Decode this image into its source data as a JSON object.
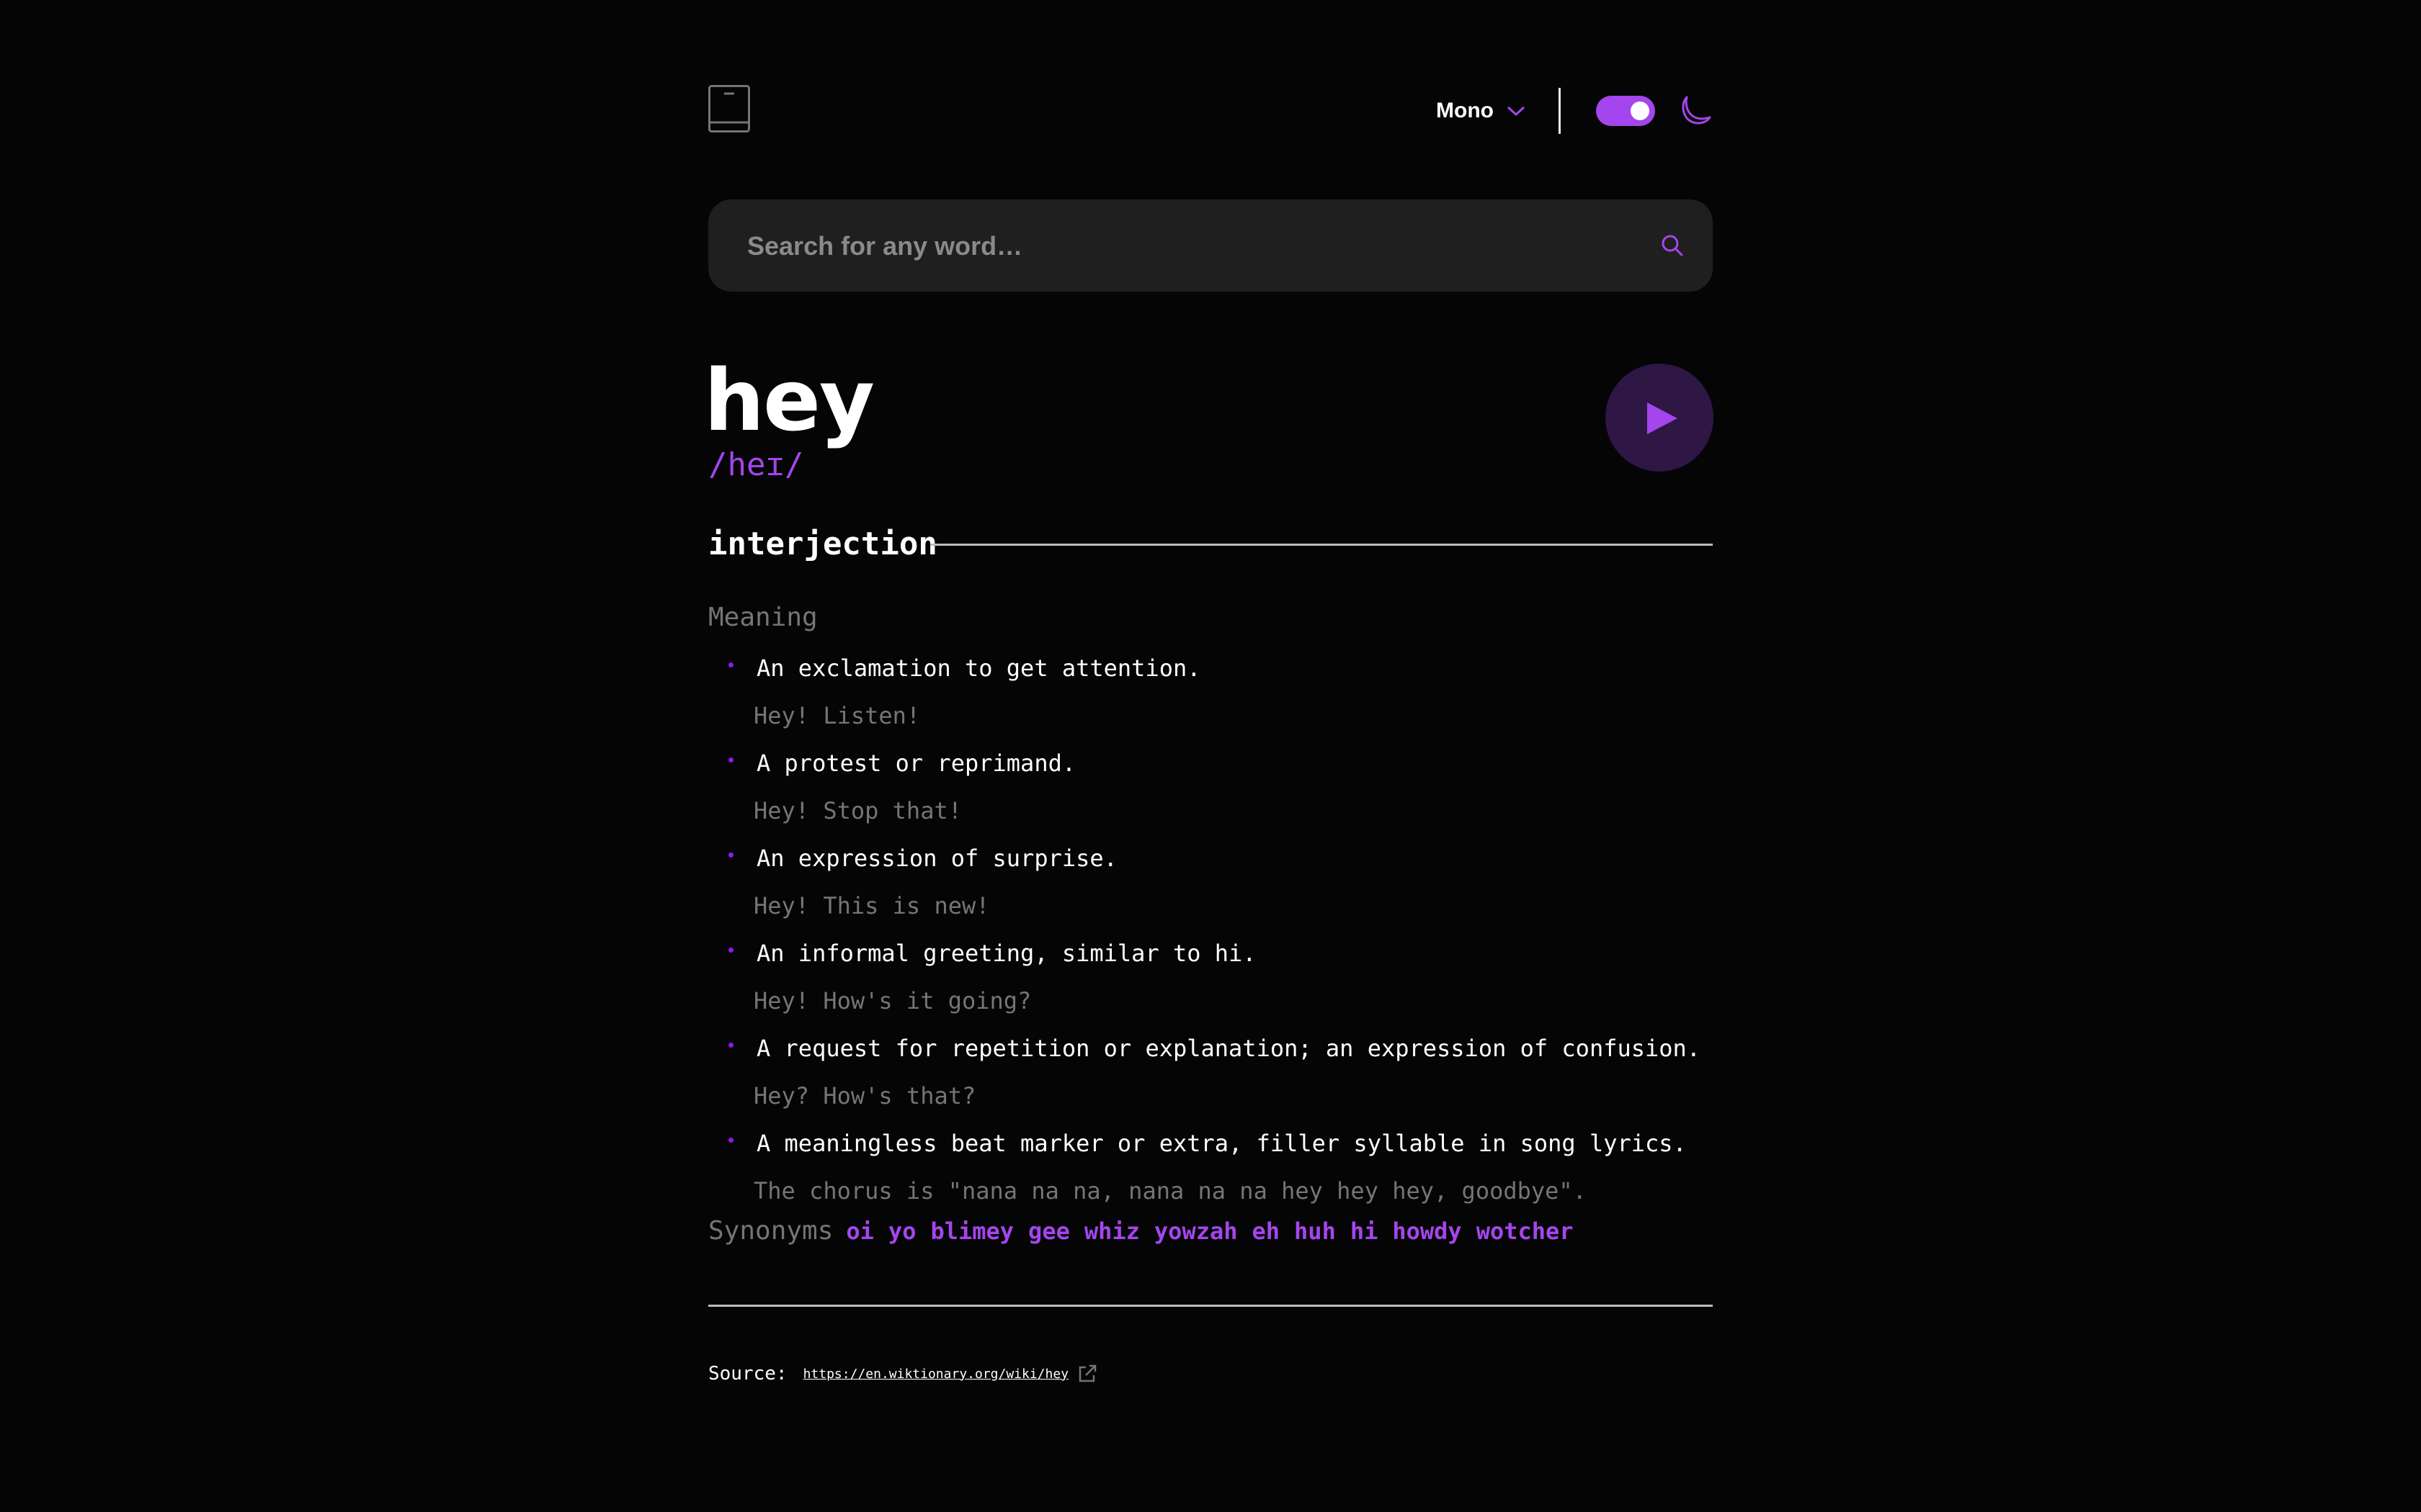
{
  "theme": {
    "accent": "#a445ed",
    "background": "#050505",
    "dark_mode": true
  },
  "header": {
    "logo_icon": "book-icon",
    "font_selector": {
      "selected": "Mono",
      "icon": "chevron-down-icon"
    },
    "theme_toggle": {
      "state": "on"
    },
    "theme_icon": "moon-icon"
  },
  "search": {
    "placeholder": "Search for any word…",
    "value": "",
    "icon": "search-icon"
  },
  "entry": {
    "word": "hey",
    "phonetic": "/heɪ/",
    "play_icon": "play-icon",
    "part_of_speech": "interjection",
    "meaning_label": "Meaning",
    "definitions": [
      {
        "text": "An exclamation to get attention.",
        "example": "Hey! Listen!"
      },
      {
        "text": "A protest or reprimand.",
        "example": "Hey! Stop that!"
      },
      {
        "text": "An expression of surprise.",
        "example": "Hey! This is new!"
      },
      {
        "text": "An informal greeting, similar to hi.",
        "example": "Hey! How's it going?"
      },
      {
        "text": "A request for repetition or explanation; an expression of confusion.",
        "example": "Hey? How's that?"
      },
      {
        "text": "A meaningless beat marker or extra, filler syllable in song lyrics.",
        "example": "The chorus is \"nana na na, nana na na hey hey hey, goodbye\"."
      }
    ],
    "synonyms_label": "Synonyms",
    "synonyms": [
      "oi",
      "yo",
      "blimey",
      "gee",
      "whiz",
      "yowzah",
      "eh",
      "huh",
      "hi",
      "howdy",
      "wotcher"
    ]
  },
  "footer": {
    "source_label": "Source:",
    "source_url": "https://en.wiktionary.org/wiki/hey",
    "link_icon": "external-link-icon"
  }
}
